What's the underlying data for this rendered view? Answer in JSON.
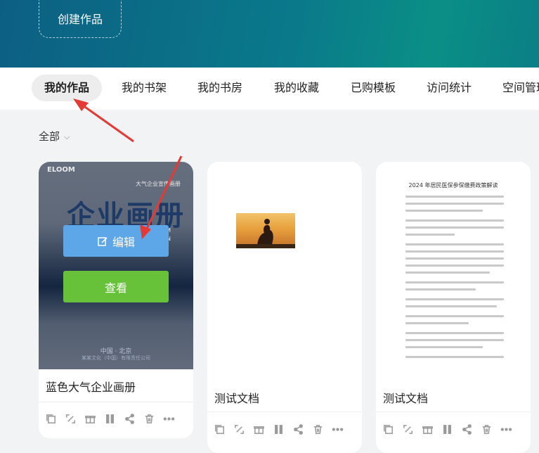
{
  "header": {
    "create_label": "创建作品"
  },
  "tabs": [
    {
      "label": "我的作品",
      "active": true
    },
    {
      "label": "我的书架"
    },
    {
      "label": "我的书房"
    },
    {
      "label": "我的收藏"
    },
    {
      "label": "已购模板"
    },
    {
      "label": "访问统计"
    },
    {
      "label": "空间管理"
    }
  ],
  "filter": {
    "label": "全部"
  },
  "cards": [
    {
      "title": "蓝色大气企业画册",
      "cover": {
        "brand": "ELOOM",
        "subtitle": "大气企业宣传画册",
        "headline": "企业画册",
        "en_line1": "UM",
        "en_line2": "GN",
        "city": "中国 · 北京",
        "company": "某某文化（中国）有限责任公司"
      },
      "edit_label": "编辑",
      "view_label": "查看"
    },
    {
      "title": "测试文档"
    },
    {
      "title": "测试文档",
      "doc_heading": "2024 年居民医保参保缴费政策解读"
    }
  ],
  "annotation_color": "#e53935"
}
